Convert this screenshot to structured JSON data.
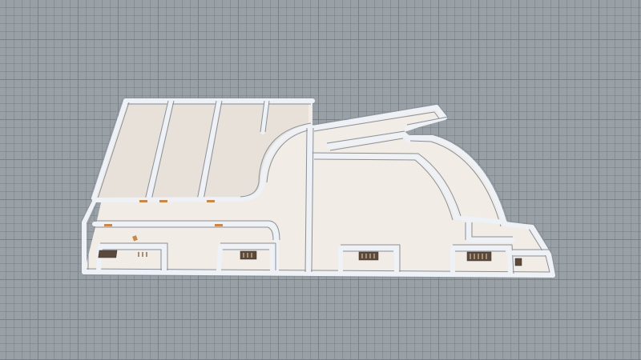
{
  "scene": {
    "background_color": "#9aa1a6",
    "grid_color": "#788086",
    "floor_color": "#f1ece6",
    "wall_color": "#f4f6f9",
    "furniture_color": "#5b4a3b"
  },
  "icons": {
    "grid": "ground-grid",
    "plan": "3d-floor-plan"
  }
}
